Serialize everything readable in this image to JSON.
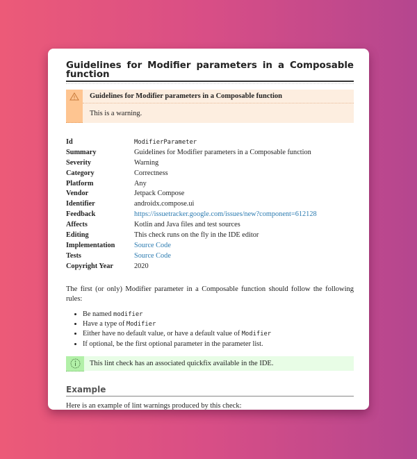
{
  "page": {
    "title": "Guidelines for Modifier parameters in a Composable function"
  },
  "warning_box": {
    "icon": "warning-triangle-icon",
    "title": "Guidelines for Modifier parameters in a Composable function",
    "text": "This is a warning."
  },
  "meta": [
    {
      "key": "Id",
      "value": "ModifierParameter",
      "kind": "mono"
    },
    {
      "key": "Summary",
      "value": "Guidelines for Modifier parameters in a Composable function",
      "kind": "text"
    },
    {
      "key": "Severity",
      "value": "Warning",
      "kind": "text"
    },
    {
      "key": "Category",
      "value": "Correctness",
      "kind": "text"
    },
    {
      "key": "Platform",
      "value": "Any",
      "kind": "text"
    },
    {
      "key": "Vendor",
      "value": "Jetpack Compose",
      "kind": "text"
    },
    {
      "key": "Identifier",
      "value": "androidx.compose.ui",
      "kind": "text"
    },
    {
      "key": "Feedback",
      "value": "https://issuetracker.google.com/issues/new?component=612128",
      "kind": "link"
    },
    {
      "key": "Affects",
      "value": "Kotlin and Java files and test sources",
      "kind": "text"
    },
    {
      "key": "Editing",
      "value": "This check runs on the fly in the IDE editor",
      "kind": "text"
    },
    {
      "key": "Implementation",
      "value": "Source Code",
      "kind": "link"
    },
    {
      "key": "Tests",
      "value": "Source Code",
      "kind": "link"
    },
    {
      "key": "Copyright Year",
      "value": "2020",
      "kind": "text"
    }
  ],
  "intro": "The first (or only) Modifier parameter in a Composable function should follow the following rules:",
  "rules": [
    {
      "before": "Be named ",
      "code": "modifier",
      "after": ""
    },
    {
      "before": "Have a type of ",
      "code": "Modifier",
      "after": ""
    },
    {
      "before": "Either have no default value, or have a default value of ",
      "code": "Modifier",
      "after": ""
    },
    {
      "before": "If optional, be the first optional parameter in the parameter list.",
      "code": "",
      "after": ""
    }
  ],
  "info_box": {
    "icon": "info-circle-icon",
    "text": "This lint check has an associated quickfix available in the IDE."
  },
  "example": {
    "heading": "Example",
    "text": "Here is an example of lint warnings produced by this check:"
  },
  "colors": {
    "link": "#2a7ab0",
    "warning_bg": "#fdeee0",
    "warning_accent": "#fec591",
    "info_bg": "#e8fde6",
    "info_accent": "#b2f0a8"
  }
}
